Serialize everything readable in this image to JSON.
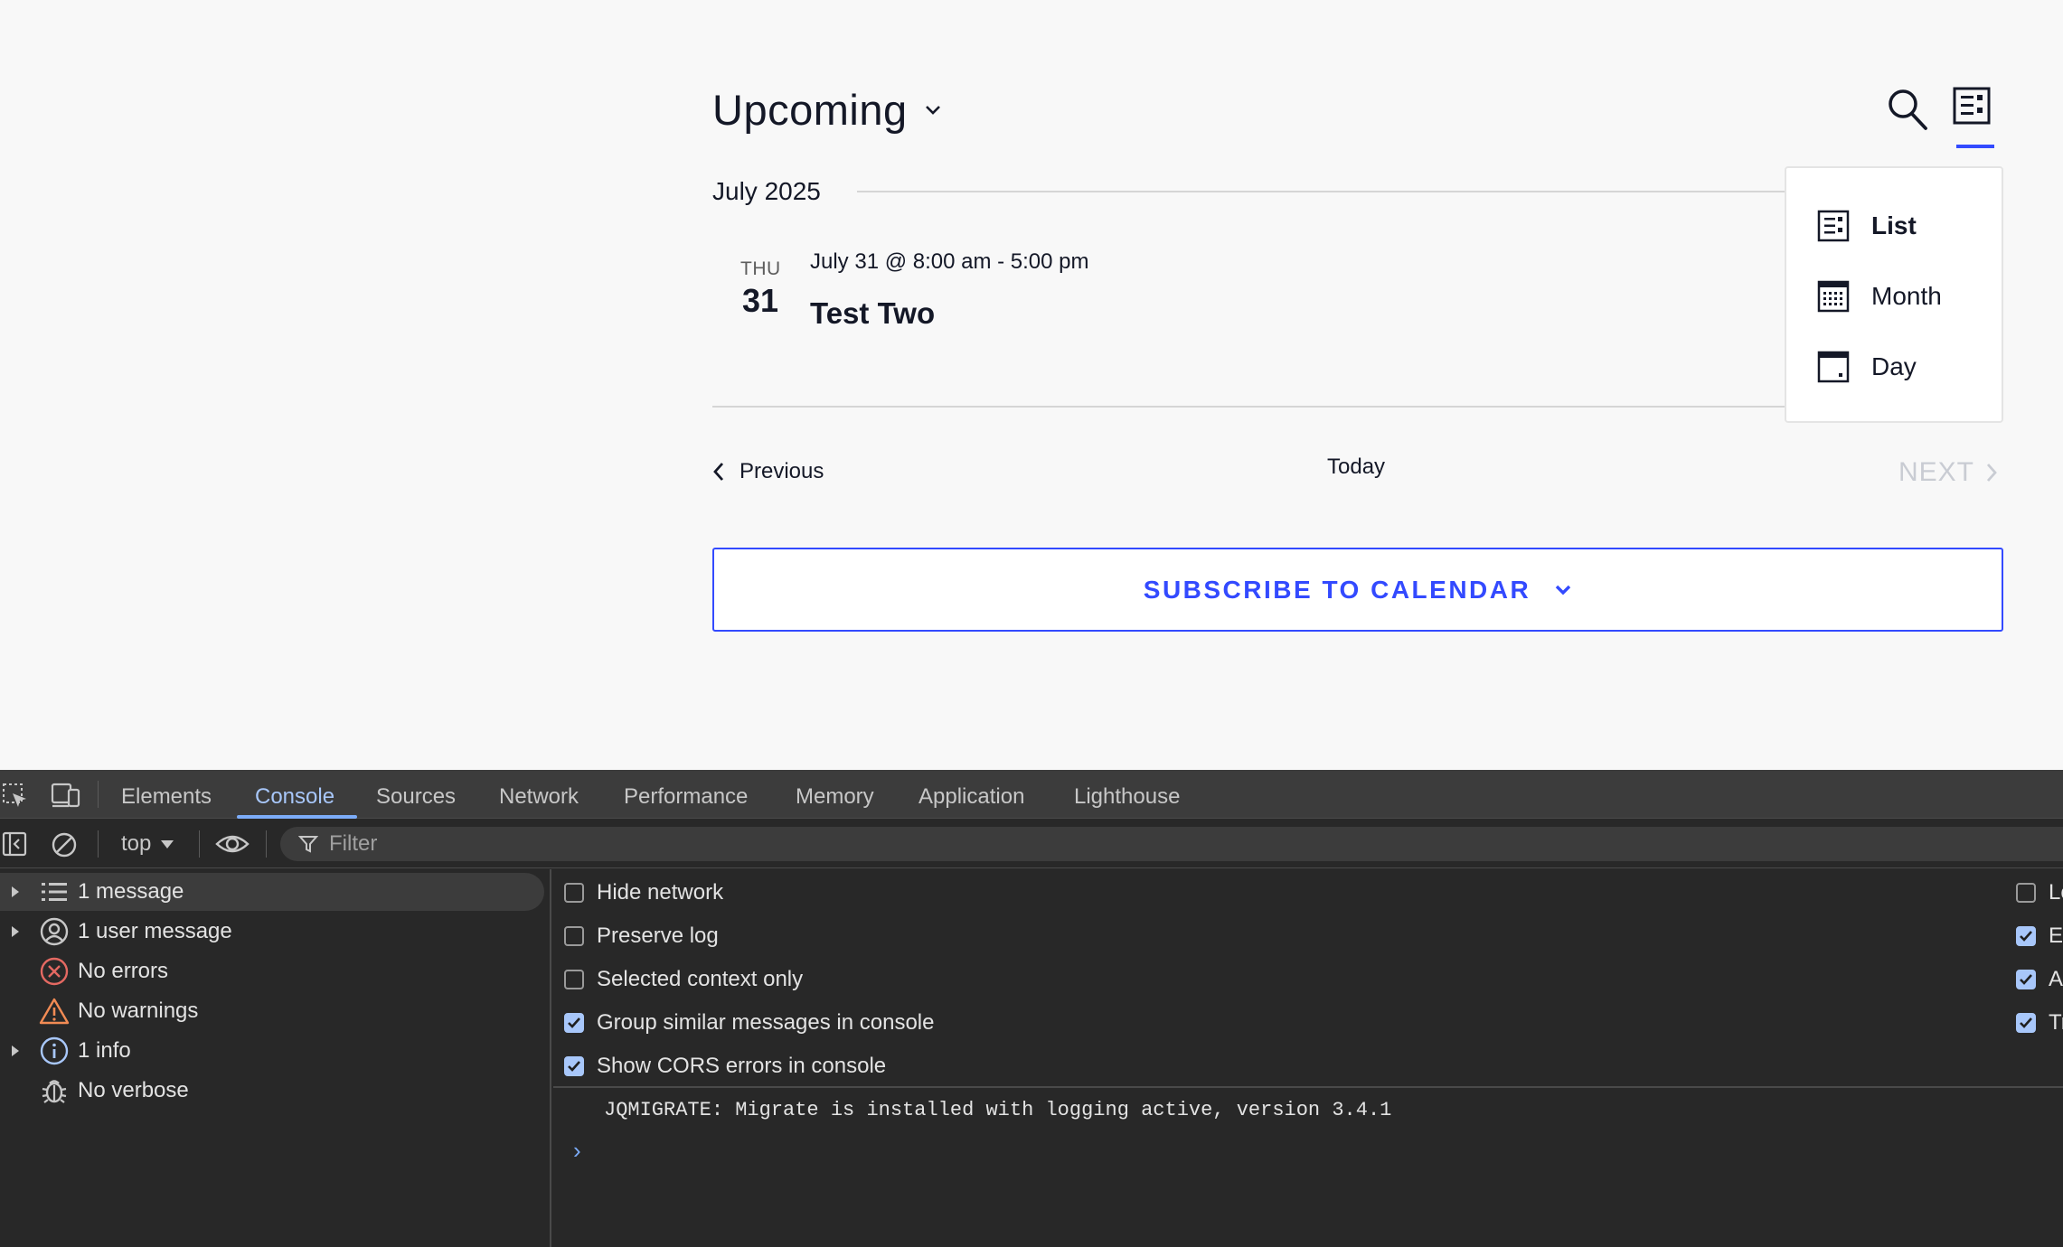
{
  "calendar": {
    "view_title": "Upcoming",
    "month_label": "July 2025",
    "event": {
      "day_of_week": "THU",
      "day_number": "31",
      "time": "July 31 @ 8:00 am - 5:00 pm",
      "title": "Test Two"
    },
    "nav": {
      "previous": "Previous",
      "today": "Today",
      "next": "NEXT"
    },
    "subscribe_label": "SUBSCRIBE TO CALENDAR",
    "view_menu": {
      "items": [
        {
          "label": "List",
          "icon": "list-view-icon",
          "active": true
        },
        {
          "label": "Month",
          "icon": "month-view-icon",
          "active": false
        },
        {
          "label": "Day",
          "icon": "day-view-icon",
          "active": false
        }
      ]
    },
    "accent_color": "#334aff"
  },
  "devtools": {
    "tabs": [
      "Elements",
      "Console",
      "Sources",
      "Network",
      "Performance",
      "Memory",
      "Application",
      "Lighthouse"
    ],
    "active_tab": "Console",
    "context": "top",
    "filter_placeholder": "Filter",
    "sidebar": [
      {
        "label": "1 message",
        "icon": "list-icon",
        "expandable": true,
        "selected": true
      },
      {
        "label": "1 user message",
        "icon": "user-icon",
        "expandable": true,
        "selected": false
      },
      {
        "label": "No errors",
        "icon": "error-icon",
        "expandable": false,
        "selected": false
      },
      {
        "label": "No warnings",
        "icon": "warning-icon",
        "expandable": false,
        "selected": false
      },
      {
        "label": "1 info",
        "icon": "info-icon",
        "expandable": true,
        "selected": false
      },
      {
        "label": "No verbose",
        "icon": "bug-icon",
        "expandable": false,
        "selected": false
      }
    ],
    "options_left": [
      {
        "label": "Hide network",
        "checked": false
      },
      {
        "label": "Preserve log",
        "checked": false
      },
      {
        "label": "Selected context only",
        "checked": false
      },
      {
        "label": "Group similar messages in console",
        "checked": true
      },
      {
        "label": "Show CORS errors in console",
        "checked": true
      }
    ],
    "options_right": [
      {
        "label": "Lo",
        "checked": false
      },
      {
        "label": "E",
        "checked": true
      },
      {
        "label": "A",
        "checked": true
      },
      {
        "label": "Tr",
        "checked": true
      }
    ],
    "console_message": "JQMIGRATE: Migrate is installed with logging active, version 3.4.1",
    "prompt": "›"
  }
}
